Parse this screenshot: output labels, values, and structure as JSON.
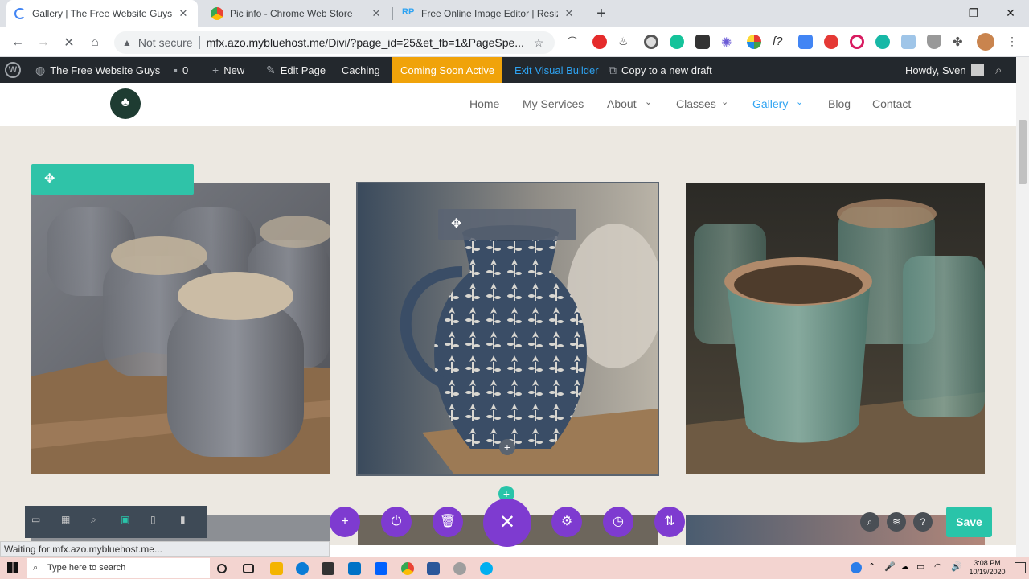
{
  "browser": {
    "tabs": [
      {
        "title": "Gallery | The Free Website Guys",
        "active": true
      },
      {
        "title": "Pic info - Chrome Web Store",
        "active": false
      },
      {
        "title": "Free Online Image Editor | Resize",
        "active": false
      }
    ],
    "new_tab": "+",
    "window_buttons": {
      "minimize": "—",
      "restore": "❐",
      "close": "✕"
    },
    "nav": {
      "back": "←",
      "forward": "→",
      "stop": "✕",
      "home": "⌂"
    },
    "omnibox": {
      "security": "Not secure",
      "url": "mfx.azo.mybluehost.me/Divi/?page_id=25&et_fb=1&PageSpe..."
    }
  },
  "wpbar": {
    "site_name": "The Free Website Guys",
    "comments": "0",
    "new": "New",
    "edit_page": "Edit Page",
    "caching": "Caching",
    "coming_soon": "Coming Soon Active",
    "exit_builder": "Exit Visual Builder",
    "copy_draft": "Copy to a new draft",
    "howdy": "Howdy, Sven"
  },
  "site_nav": {
    "logo_text": "♣",
    "items": [
      "Home",
      "My Services",
      "About",
      "Classes",
      "Gallery",
      "Blog",
      "Contact"
    ],
    "current": "Gallery"
  },
  "builder": {
    "save": "Save",
    "status": "Waiting for mfx.azo.mybluehost.me..."
  },
  "taskbar": {
    "search_placeholder": "Type here to search",
    "time": "3:08 PM",
    "date": "10/19/2020"
  },
  "colors": {
    "wp_bar": "#23282d",
    "coming_soon": "#f0a30a",
    "divi_blue": "#2ea3f2",
    "divi_teal": "#29c4a9",
    "divi_purple": "#7e3bd0"
  }
}
